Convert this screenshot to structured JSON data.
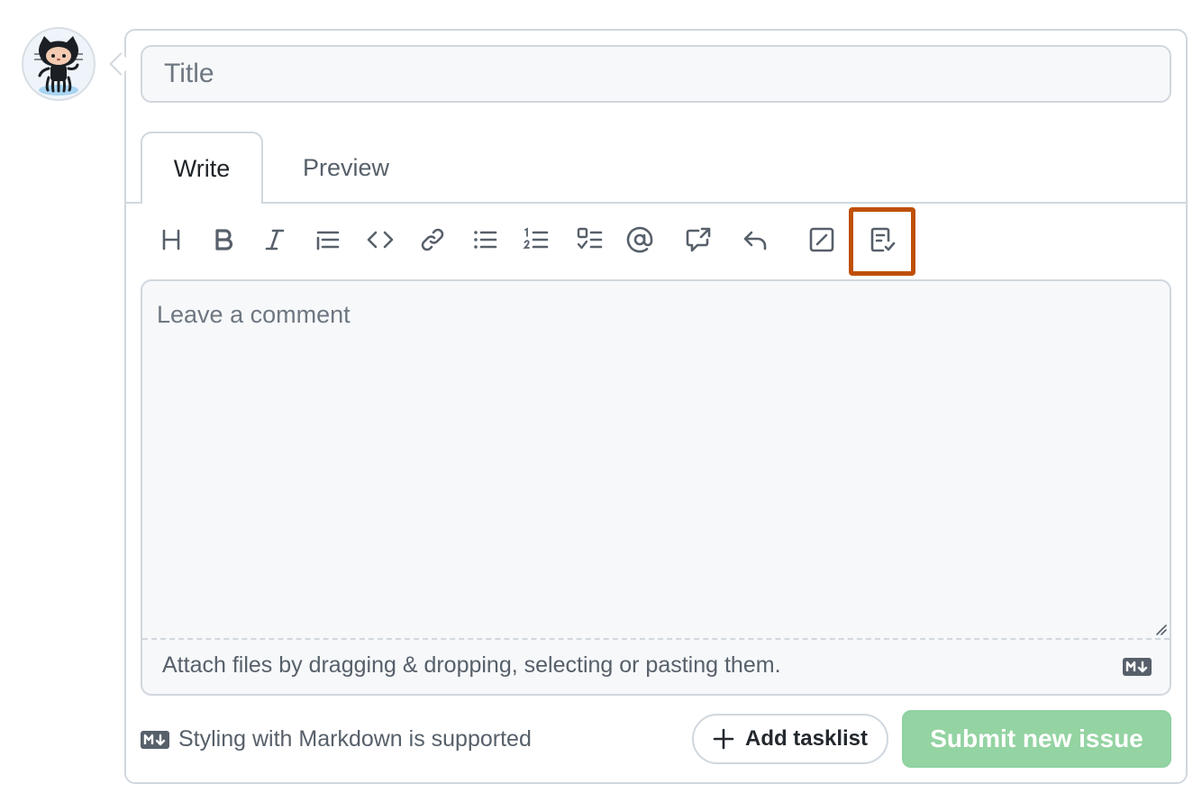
{
  "title_field": {
    "placeholder": "Title",
    "value": ""
  },
  "tabs": [
    {
      "label": "Write",
      "selected": true
    },
    {
      "label": "Preview",
      "selected": false
    }
  ],
  "toolbar": {
    "tools": [
      {
        "name": "heading",
        "icon": "heading-icon"
      },
      {
        "name": "bold",
        "icon": "bold-icon"
      },
      {
        "name": "italic",
        "icon": "italic-icon"
      },
      {
        "name": "quote",
        "icon": "quote-icon"
      },
      {
        "name": "code",
        "icon": "code-icon"
      },
      {
        "name": "link",
        "icon": "link-icon"
      },
      {
        "name": "unordered-list",
        "icon": "list-unordered-icon"
      },
      {
        "name": "ordered-list",
        "icon": "list-ordered-icon"
      },
      {
        "name": "task-list",
        "icon": "tasklist-icon"
      },
      {
        "name": "mention",
        "icon": "mention-icon"
      },
      {
        "name": "cross-reference",
        "icon": "cross-reference-icon"
      },
      {
        "name": "saved-reply",
        "icon": "reply-icon"
      },
      {
        "name": "slash-commands",
        "icon": "slash-command-icon"
      },
      {
        "name": "issue-form",
        "icon": "file-check-icon",
        "highlighted": true
      }
    ],
    "highlight_color": "#bf5006"
  },
  "comment": {
    "placeholder": "Leave a comment",
    "value": "",
    "attach_text": "Attach files by dragging & dropping, selecting or pasting them."
  },
  "footer": {
    "markdown_note": "Styling with Markdown is supported",
    "add_tasklist_label": "Add tasklist",
    "submit_label": "Submit new issue",
    "submit_disabled": true
  },
  "colors": {
    "border": "#d0d7de",
    "input_bg": "#f6f8fa",
    "muted_text": "#57606a",
    "submit_bg": "#94d3a2"
  }
}
